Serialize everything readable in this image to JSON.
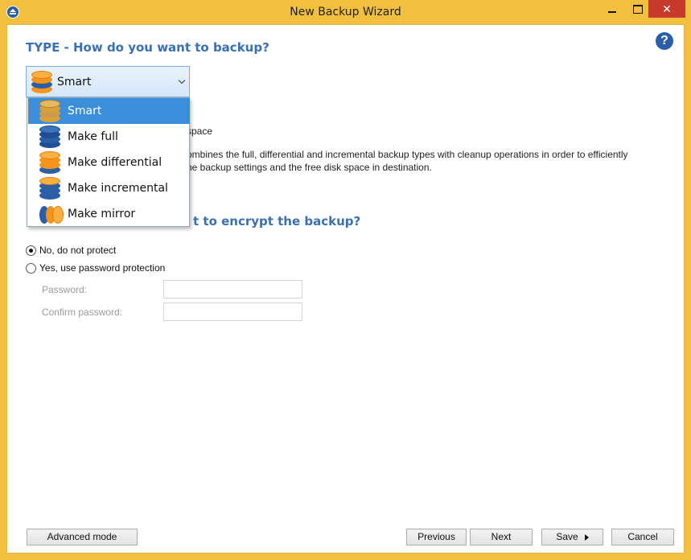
{
  "window": {
    "title": "New Backup Wizard",
    "close_glyph": "✕"
  },
  "help": {
    "glyph": "?"
  },
  "type_section": {
    "heading": "TYPE - How do you want to backup?",
    "selected": "Smart",
    "options": [
      "Smart",
      "Make full",
      "Make differential",
      "Make incremental",
      "Make mirror"
    ],
    "desc_title_fragment": "space",
    "desc_line1_fragment": "ombines the full, differential and incremental backup types with cleanup operations in order to efficiently",
    "desc_line2_fragment": "he backup settings and the free disk space in destination."
  },
  "encryption_section": {
    "heading_fragment": "t to encrypt the backup?",
    "options": [
      "No, do not protect",
      "Yes, use password protection"
    ],
    "selected_index": 0,
    "password_label": "Password:",
    "confirm_label": "Confirm password:"
  },
  "buttons": {
    "advanced": "Advanced mode",
    "previous": "Previous",
    "next": "Next",
    "save": "Save",
    "cancel": "Cancel"
  },
  "colors": {
    "frame": "#f2bf3f",
    "accent_heading": "#3a70b0",
    "selection": "#3b8ed9",
    "coin_orange": "#f7941d",
    "coin_blue": "#2a5fa7"
  }
}
